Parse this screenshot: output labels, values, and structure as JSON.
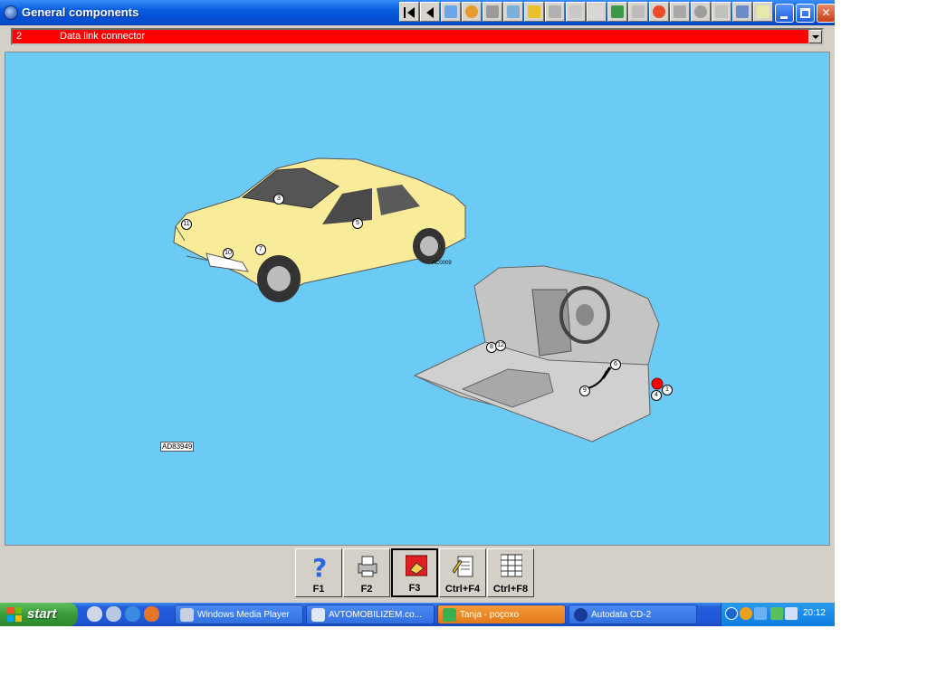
{
  "window": {
    "title": "General components",
    "icon": "app-globe-icon",
    "toolbar_icons": [
      "first-page-icon",
      "prev-page-icon",
      "tool-1-icon",
      "tool-2-icon",
      "tool-3-icon",
      "tool-4-icon",
      "tool-5-icon",
      "tool-6-icon",
      "tool-7-icon",
      "tool-8-icon",
      "tool-9-icon",
      "tool-10-icon",
      "tool-11-icon",
      "tool-12-icon",
      "tool-13-icon",
      "tool-14-icon",
      "tool-15-icon",
      "tool-16-icon"
    ],
    "controls": {
      "minimize": "minimize-icon",
      "maximize": "maximize-icon",
      "close": "close-icon",
      "close_glyph": "✕"
    }
  },
  "selector": {
    "number": "2",
    "label": "Data link connector",
    "background": "#ff0000"
  },
  "diagram": {
    "background": "#6ccbf5",
    "car_callouts": [
      "3",
      "11",
      "10",
      "7",
      "5"
    ],
    "car_code": "AC0009",
    "cabin_callouts": [
      "8",
      "12",
      "6",
      "9",
      "4",
      "1"
    ],
    "main_code": "AD83949",
    "highlight_color": "#ff0000"
  },
  "function_keys": [
    {
      "key": "F1",
      "icon": "help-question-icon",
      "active": false
    },
    {
      "key": "F2",
      "icon": "printer-icon",
      "active": false
    },
    {
      "key": "F3",
      "icon": "red-book-icon",
      "active": true
    },
    {
      "key": "Ctrl+F4",
      "icon": "notepad-pencil-icon",
      "active": false
    },
    {
      "key": "Ctrl+F8",
      "icon": "table-list-icon",
      "active": false
    }
  ],
  "taskbar": {
    "start_label": "start",
    "tasks": [
      {
        "label": "Windows Media Player",
        "active": false
      },
      {
        "label": "AVTOMOBILIZEM.co...",
        "active": false
      },
      {
        "label": "Tanja - poçoxo",
        "active": true
      },
      {
        "label": "Autodata CD-2",
        "active": false
      }
    ],
    "clock": "20:12"
  }
}
